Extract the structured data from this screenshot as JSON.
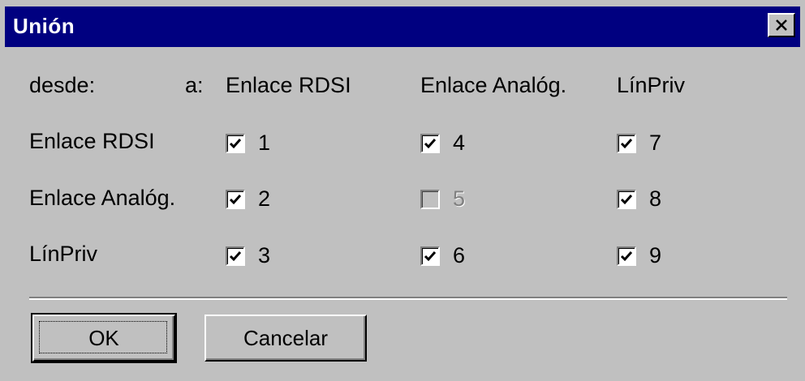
{
  "window": {
    "title": "Unión"
  },
  "header": {
    "from_label": "desde:",
    "to_label": "a:",
    "columns": [
      "Enlace RDSI",
      "Enlace Analóg.",
      "LínPriv"
    ]
  },
  "rows": [
    {
      "label": "Enlace RDSI",
      "cells": [
        {
          "label": "1",
          "checked": true,
          "enabled": true
        },
        {
          "label": "4",
          "checked": true,
          "enabled": true
        },
        {
          "label": "7",
          "checked": true,
          "enabled": true
        }
      ]
    },
    {
      "label": "Enlace Analóg.",
      "cells": [
        {
          "label": "2",
          "checked": true,
          "enabled": true
        },
        {
          "label": "5",
          "checked": false,
          "enabled": false
        },
        {
          "label": "8",
          "checked": true,
          "enabled": true
        }
      ]
    },
    {
      "label": "LínPriv",
      "cells": [
        {
          "label": "3",
          "checked": true,
          "enabled": true
        },
        {
          "label": "6",
          "checked": true,
          "enabled": true
        },
        {
          "label": "9",
          "checked": true,
          "enabled": true
        }
      ]
    }
  ],
  "buttons": {
    "ok": "OK",
    "cancel": "Cancelar"
  },
  "colors": {
    "titlebar": "#000080",
    "face": "#c0c0c0",
    "disabled_text": "#808080"
  },
  "icons": {
    "close": "close-icon",
    "check": "checkmark-icon"
  }
}
